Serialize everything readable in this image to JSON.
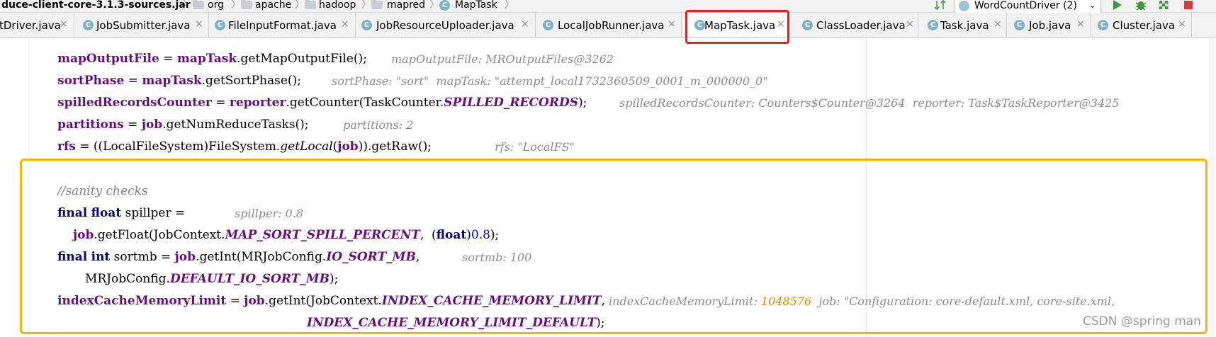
{
  "breadcrumb": {
    "items": [
      "duce-client-core-3.1.3-sources.jar",
      "org",
      "apache",
      "hadoop",
      "mapred",
      "MapTask"
    ],
    "separator": "〉"
  },
  "toolbar": {
    "run_config": "WordCountDriver (2)",
    "icons": [
      "sort-icon",
      "dropdown-icon",
      "run-icon",
      "debug-icon",
      "coverage-icon",
      "stop-icon"
    ]
  },
  "tabs": [
    {
      "label": "tDriver.java",
      "active": false
    },
    {
      "label": "JobSubmitter.java",
      "active": false
    },
    {
      "label": "FileInputFormat.java",
      "active": false
    },
    {
      "label": "JobResourceUploader.java",
      "active": false
    },
    {
      "label": "LocalJobRunner.java",
      "active": false
    },
    {
      "label": "MapTask.java",
      "active": true
    },
    {
      "label": "ClassLoader.java",
      "active": false
    },
    {
      "label": "Task.java",
      "active": false
    },
    {
      "label": "Job.java",
      "active": false
    },
    {
      "label": "Cluster.java",
      "active": false
    }
  ],
  "tab_close_glyph": "×",
  "code": {
    "line1": {
      "var": "mapOutputFile",
      "op": " = ",
      "obj": "mapTask",
      "call": ".getMapOutputFile();",
      "hint": "mapOutputFile: MROutputFiles@3262"
    },
    "line2": {
      "var": "sortPhase",
      "op": " = ",
      "obj": "mapTask",
      "call": ".getSortPhase();",
      "hint": "sortPhase: \"sort\"  mapTask: \"attempt_local1732360509_0001_m_000000_0\""
    },
    "line3": {
      "var": "spilledRecordsCounter",
      "op": " = ",
      "obj": "reporter",
      "call": ".getCounter(TaskCounter.",
      "const": "SPILLED_RECORDS",
      "end": ");",
      "hint": "spilledRecordsCounter: Counters$Counter@3264  reporter: Task$TaskReporter@3425"
    },
    "line4": {
      "var": "partitions",
      "op": " = ",
      "obj": "job",
      "call": ".getNumReduceTasks();",
      "hint": "partitions: 2"
    },
    "line5": {
      "var": "rfs",
      "pre": " = ((LocalFileSystem)FileSystem.",
      "method": "getLocal",
      "open": "(",
      "obj": "job",
      "end": ")).getRaw();",
      "hint": "rfs: \"LocalFS\""
    },
    "comment": "//sanity checks",
    "line6": {
      "kw1": "final",
      "kw2": "float",
      "rest": " spillper = ",
      "hint": "spillper: 0.8"
    },
    "line7": {
      "obj": "job",
      "call": ".getFloat(JobContext.",
      "const": "MAP_SORT_SPILL_PERCENT",
      "mid": ",  (",
      "kw": "float",
      "close": ")",
      "num": "0.8",
      "end": ");"
    },
    "line8": {
      "kw1": "final",
      "kw2": "int",
      "rest": " sortmb = ",
      "obj": "job",
      "call": ".getInt(MRJobConfig.",
      "const": "IO_SORT_MB",
      "end": ",",
      "hint": "sortmb: 100"
    },
    "line9": {
      "pre": "MRJobConfig.",
      "const": "DEFAULT_IO_SORT_MB",
      "end": ");"
    },
    "line10": {
      "var": "indexCacheMemoryLimit",
      "op": " = ",
      "obj": "job",
      "call": ".getInt(JobContext.",
      "const": "INDEX_CACHE_MEMORY_LIMIT",
      "end": ",",
      "hint_label": "indexCacheMemoryLimit: ",
      "hint_value": "1048576",
      "hint_rest": "  job: \"Configuration: core-default.xml, core-site.xml,"
    },
    "line11": {
      "const": "INDEX_CACHE_MEMORY_LIMIT_DEFAULT",
      "end": ");"
    }
  },
  "watermark": "CSDN @spring man",
  "colors": {
    "highlight_yellow": "#f7b500",
    "highlight_red": "#f21b1b"
  }
}
